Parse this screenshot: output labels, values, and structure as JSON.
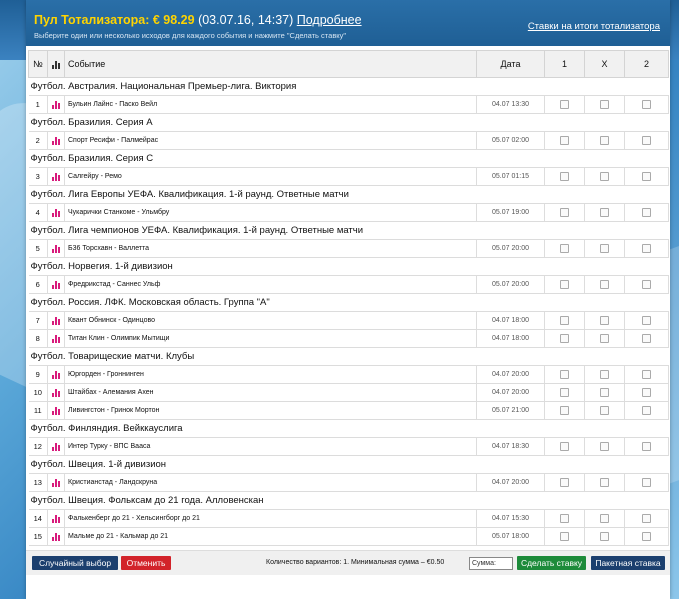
{
  "header": {
    "title_prefix": "Пул Тотализатора: ",
    "amount": "€ 98.29",
    "date": " (03.07.16, 14:37) ",
    "more_link": "Подробнее",
    "subtitle": "Выберите один или несколько исходов для каждого события и нажмите \"Сделать ставку\"",
    "results_link": "Ставки на итоги тотализатора"
  },
  "columns": {
    "num": "№",
    "event": "Событие",
    "date": "Дата",
    "c1": "1",
    "cx": "X",
    "c2": "2"
  },
  "groups": [
    {
      "name": "Футбол. Австралия. Национальная Премьер-лига. Виктория",
      "events": [
        {
          "num": "1",
          "name": "Бульин Лайнс - Паско Вейл",
          "date": "04.07 13:30"
        }
      ]
    },
    {
      "name": "Футбол. Бразилия. Серия А",
      "events": [
        {
          "num": "2",
          "name": "Спорт Ресифи - Палмейрас",
          "date": "05.07 02:00"
        }
      ]
    },
    {
      "name": "Футбол. Бразилия. Серия С",
      "events": [
        {
          "num": "3",
          "name": "Салгейру - Ремо",
          "date": "05.07 01:15"
        }
      ]
    },
    {
      "name": "Футбол. Лига Европы УЕФА. Квалификация. 1-й раунд. Ответные матчи",
      "events": [
        {
          "num": "4",
          "name": "Чукарички Станкоме - Ульмбру",
          "date": "05.07 19:00"
        }
      ]
    },
    {
      "name": "Футбол. Лига чемпионов УЕФА. Квалификация. 1-й раунд. Ответные матчи",
      "events": [
        {
          "num": "5",
          "name": "Б36 Торсхавн - Валлетта",
          "date": "05.07 20:00"
        }
      ]
    },
    {
      "name": "Футбол. Норвегия. 1-й дивизион",
      "events": [
        {
          "num": "6",
          "name": "Фредрикстад - Саннес Ульф",
          "date": "05.07 20:00"
        }
      ]
    },
    {
      "name": "Футбол. Россия. ЛФК. Московская область. Группа \"А\"",
      "events": [
        {
          "num": "7",
          "name": "Квант Обнинск - Одинцово",
          "date": "04.07 18:00"
        },
        {
          "num": "8",
          "name": "Титан Клин - Олимпик Мытищи",
          "date": "04.07 18:00"
        }
      ]
    },
    {
      "name": "Футбол. Товарищеские матчи. Клубы",
      "events": [
        {
          "num": "9",
          "name": "Юргорден - Гроннинген",
          "date": "04.07 20:00"
        },
        {
          "num": "10",
          "name": "Штайбах - Алемания Ахен",
          "date": "04.07 20:00"
        },
        {
          "num": "11",
          "name": "Ливингстон - Гринок Мортон",
          "date": "05.07 21:00"
        }
      ]
    },
    {
      "name": "Футбол. Финляндия. Вейккауслига",
      "events": [
        {
          "num": "12",
          "name": "Интер Турку - ВПС Вааса",
          "date": "04.07 18:30"
        }
      ]
    },
    {
      "name": "Футбол. Швеция. 1-й дивизион",
      "events": [
        {
          "num": "13",
          "name": "Кристианстад - Ландскруна",
          "date": "04.07 20:00"
        }
      ]
    },
    {
      "name": "Футбол. Швеция. Фольксам до 21 года. Алловенскан",
      "events": [
        {
          "num": "14",
          "name": "Фалькенберг до 21 - Хельсингборг до 21",
          "date": "04.07 15:30"
        },
        {
          "num": "15",
          "name": "Мальме до 21 - Кальмар до 21",
          "date": "05.07 18:00"
        }
      ]
    }
  ],
  "footer": {
    "random_button": "Случайный выбор",
    "cancel_button": "Отменить",
    "info": "Количество вариантов: 1. Минимальная сумма – €0.50",
    "sum_placeholder": "Сумма:",
    "bet_button": "Сделать ставку",
    "ticket_button": "Пакетная ставка"
  },
  "colors": {
    "header_bg": "#1f5f95",
    "amount": "#ffd400",
    "stats_icon": "#d81b7c",
    "bet_button": "#1d8b3a",
    "cancel_button": "#d2232a"
  }
}
